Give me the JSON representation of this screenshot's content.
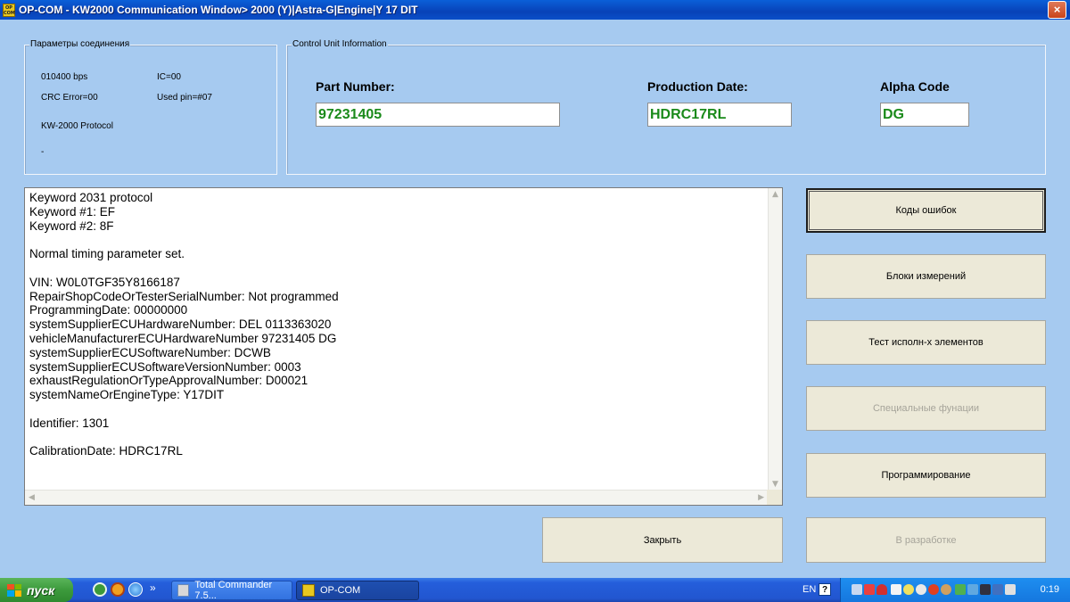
{
  "window": {
    "icon_text": "OP COM",
    "title": "OP-COM - KW2000 Communication Window> 2000 (Y)|Astra-G|Engine|Y 17 DIT",
    "close_symbol": "×"
  },
  "connection": {
    "group_title": "Параметры соединения",
    "baud": "010400 bps",
    "ic": "IC=00",
    "crc_error": "CRC Error=00",
    "used_pin": "Used pin=#07",
    "protocol": "KW-2000 Protocol",
    "extra": "-"
  },
  "control_unit": {
    "group_title": "Control Unit Information",
    "part_number_label": "Part Number:",
    "part_number_value": "97231405",
    "production_date_label": "Production Date:",
    "production_date_value": "HDRC17RL",
    "alpha_code_label": "Alpha Code",
    "alpha_code_value": "DG"
  },
  "log": {
    "lines": [
      "Keyword 2031 protocol",
      "Keyword #1: EF",
      "Keyword #2: 8F",
      "",
      "Normal timing parameter set.",
      "",
      "VIN: W0L0TGF35Y8166187",
      "RepairShopCodeOrTesterSerialNumber:  Not programmed",
      "ProgrammingDate:  00000000",
      "systemSupplierECUHardwareNumber: DEL  0113363020",
      "vehicleManufacturerECUHardwareNumber 97231405 DG",
      "systemSupplierECUSoftwareNumber: DCWB",
      "systemSupplierECUSoftwareVersionNumber: 0003",
      "exhaustRegulationOrTypeApprovalNumber: D00021",
      "systemNameOrEngineType:  Y17DIT",
      "",
      "Identifier: 1301",
      "",
      "CalibrationDate: HDRC17RL"
    ]
  },
  "buttons": {
    "error_codes": "Коды ошибок",
    "measure_blocks": "Блоки измерений",
    "actuator_test": "Тест исполн-х элементов",
    "special_functions": "Специальные фунации",
    "programming": "Программирование",
    "close": "Закрыть",
    "in_development": "В разработке"
  },
  "taskbar": {
    "start_label": "пуск",
    "overflow": "»",
    "task_total_commander": "Total Commander 7.5...",
    "task_opcom": "OP-COM",
    "language": "EN",
    "help": "?",
    "clock": "0:19"
  }
}
